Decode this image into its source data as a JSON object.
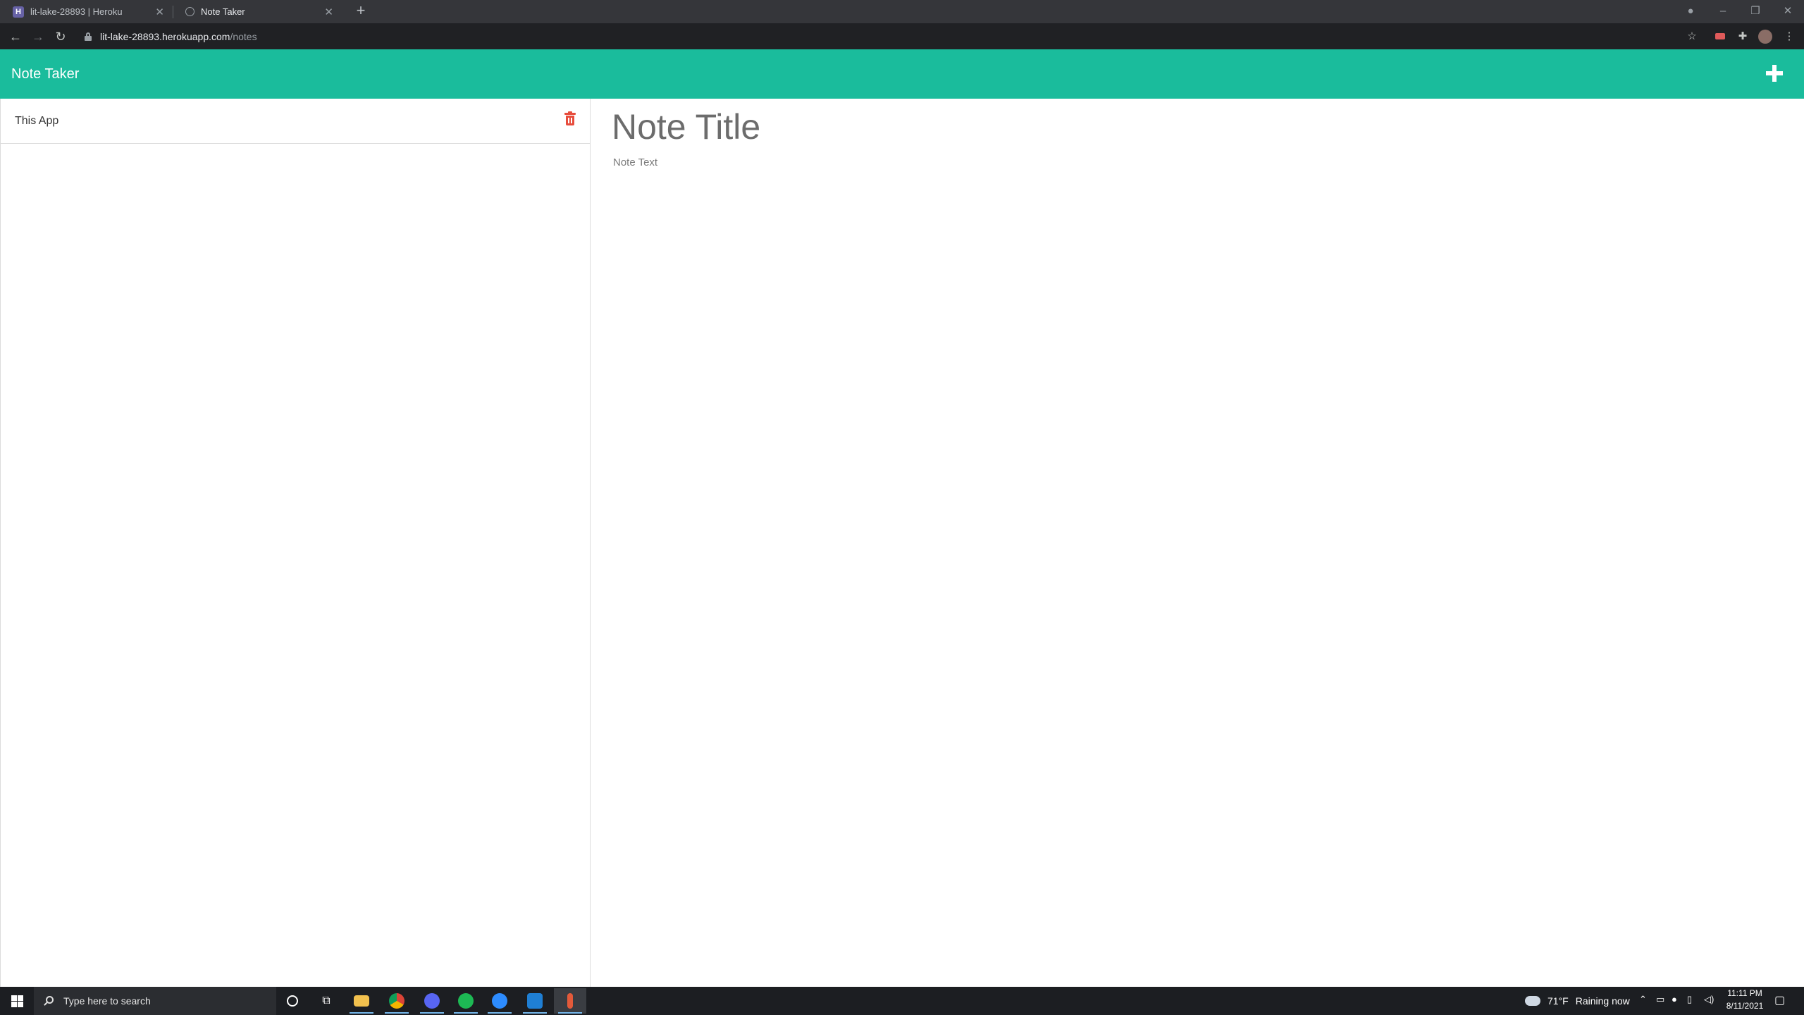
{
  "browser": {
    "tabs": [
      {
        "title": "lit-lake-28893 | Heroku",
        "active": false
      },
      {
        "title": "Note Taker",
        "active": true
      }
    ],
    "url_host": "lit-lake-28893.herokuapp.com",
    "url_path": "/notes"
  },
  "app": {
    "brand": "Note Taker",
    "accent_color": "#1abc9c",
    "delete_color": "#e74c3c",
    "notes": [
      {
        "title": "This App"
      }
    ],
    "editor": {
      "title_placeholder": "Note Title",
      "text_placeholder": "Note Text"
    }
  },
  "taskbar": {
    "search_placeholder": "Type here to search",
    "weather": {
      "temp": "71°F",
      "condition": "Raining now"
    },
    "time": "11:11 PM",
    "date": "8/11/2021"
  }
}
